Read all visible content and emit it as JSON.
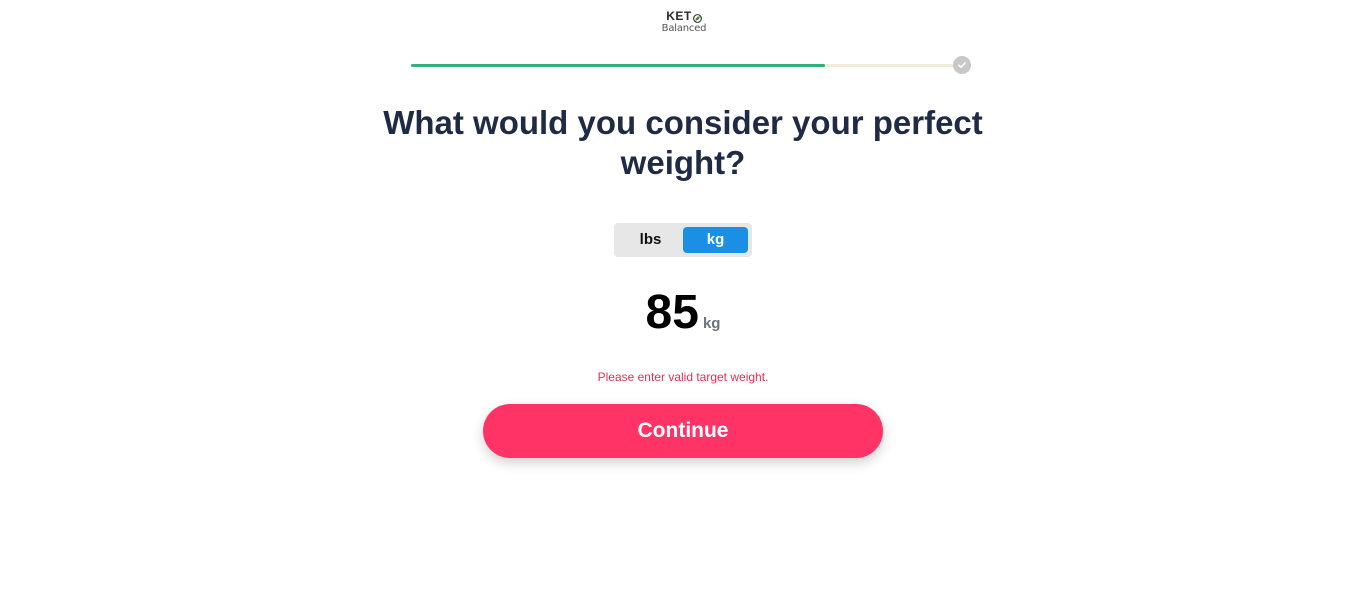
{
  "logo": {
    "top_text": "KET",
    "bottom_text": "Balanced",
    "leaf_icon": "leaf-icon",
    "leaf_color": "#4a8b2c"
  },
  "progress": {
    "value": 0.76,
    "fill_color": "#2eb27a",
    "track_color": "#f1ecdc",
    "end_icon": "check-icon"
  },
  "question": {
    "title": "What would you consider your perfect weight?"
  },
  "units": {
    "options": [
      "lbs",
      "kg"
    ],
    "selected": "kg",
    "active_color": "#1a8fe3"
  },
  "weight": {
    "value": "85",
    "unit": "kg"
  },
  "error": {
    "message": "Please enter valid target weight.",
    "color": "#e53050"
  },
  "continue_button": {
    "label": "Continue",
    "color": "#ff3366"
  }
}
